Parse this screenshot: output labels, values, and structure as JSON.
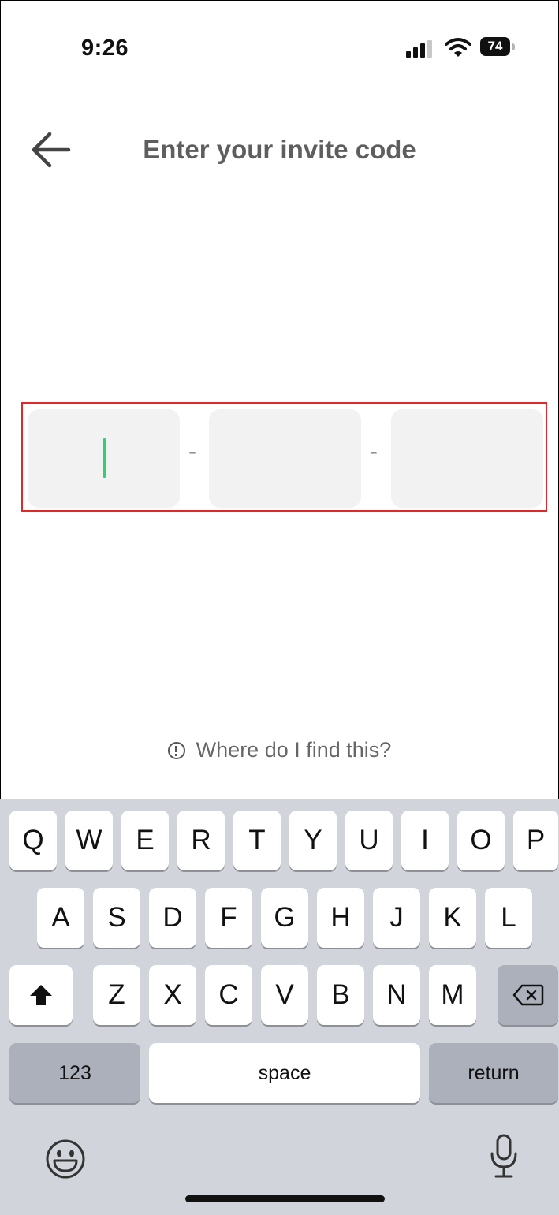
{
  "status_bar": {
    "time": "9:26",
    "battery": "74"
  },
  "header": {
    "title": "Enter your invite code"
  },
  "code_input": {
    "separator": "-"
  },
  "help": {
    "text": "Where do I find this?"
  },
  "keyboard": {
    "row1": [
      "Q",
      "W",
      "E",
      "R",
      "T",
      "Y",
      "U",
      "I",
      "O",
      "P"
    ],
    "row2": [
      "A",
      "S",
      "D",
      "F",
      "G",
      "H",
      "J",
      "K",
      "L"
    ],
    "row3": [
      "Z",
      "X",
      "C",
      "V",
      "B",
      "N",
      "M"
    ],
    "numbers_label": "123",
    "space_label": "space",
    "return_label": "return"
  },
  "colors": {
    "caret": "#2fcf72",
    "highlight_border": "#e02828",
    "input_bg": "#f2f2f2"
  }
}
